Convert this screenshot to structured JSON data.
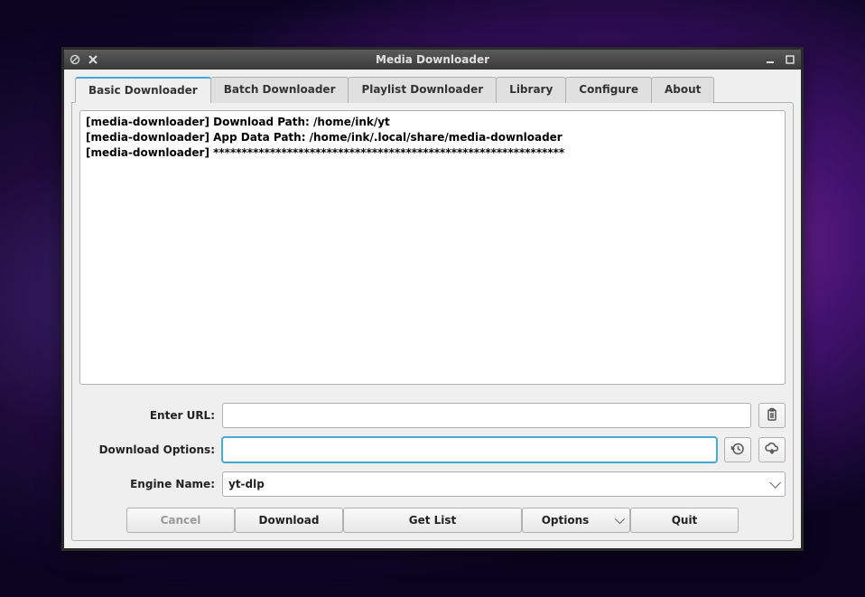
{
  "window": {
    "title": "Media Downloader"
  },
  "tabs": [
    {
      "label": "Basic Downloader"
    },
    {
      "label": "Batch Downloader"
    },
    {
      "label": "Playlist Downloader"
    },
    {
      "label": "Library"
    },
    {
      "label": "Configure"
    },
    {
      "label": "About"
    }
  ],
  "log": "[media-downloader] Download Path: /home/ink/yt\n[media-downloader] App Data Path: /home/ink/.local/share/media-downloader\n[media-downloader] **************************************************************",
  "form": {
    "url_label": "Enter URL:",
    "url_value": "",
    "options_label": "Download Options:",
    "options_value": "",
    "engine_label": "Engine Name:",
    "engine_value": "yt-dlp"
  },
  "buttons": {
    "cancel": "Cancel",
    "download": "Download",
    "getlist": "Get List",
    "options": "Options",
    "quit": "Quit"
  }
}
